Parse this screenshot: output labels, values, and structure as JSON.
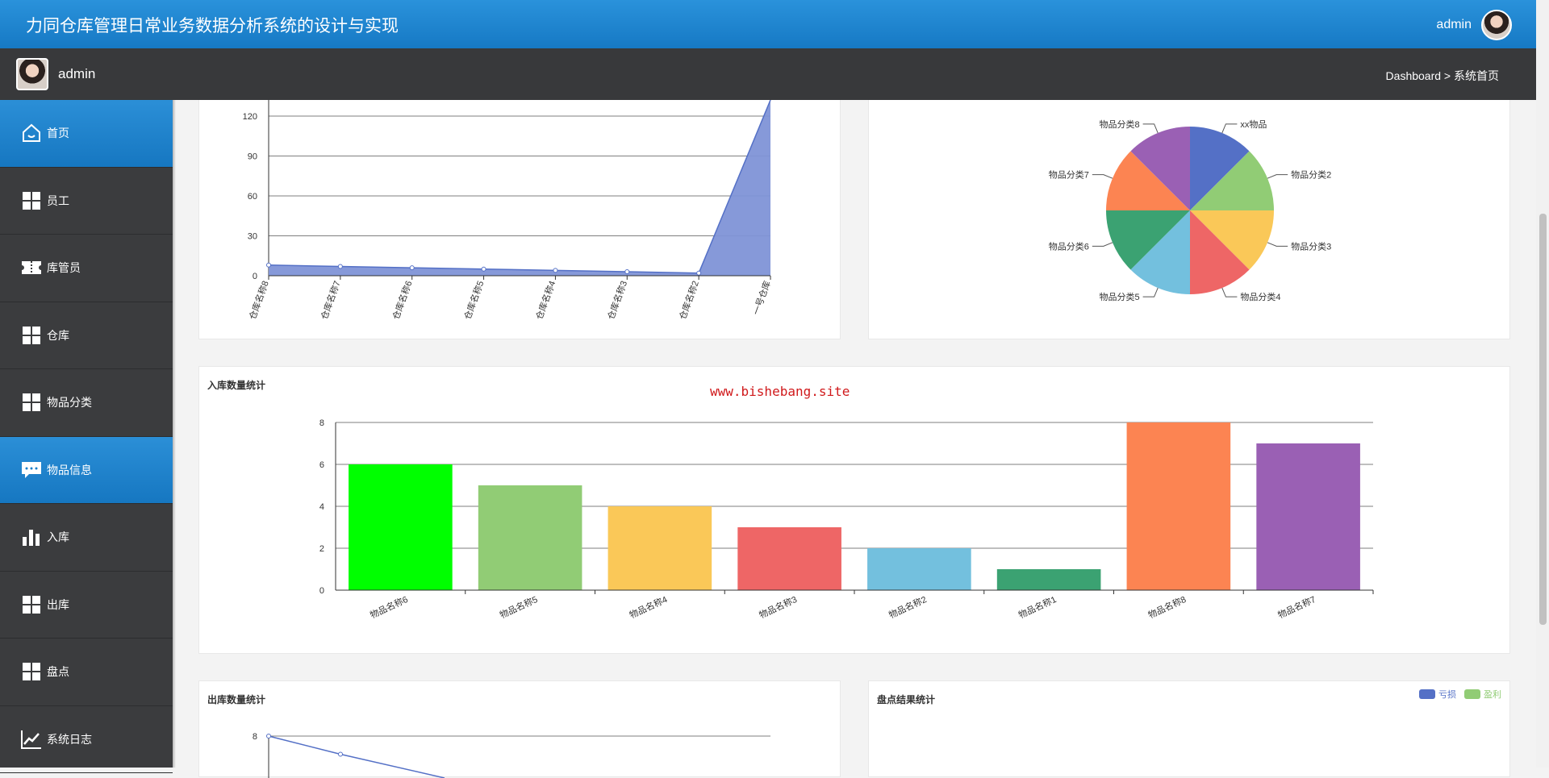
{
  "header": {
    "title": "力同仓库管理日常业务数据分析系统的设计与实现",
    "user": "admin"
  },
  "subheader": {
    "user": "admin",
    "breadcrumb": "Dashboard > 系统首页"
  },
  "sidebar": {
    "items": [
      {
        "label": "首页",
        "icon": "home-icon",
        "active": true
      },
      {
        "label": "员工",
        "icon": "grid-icon",
        "active": false
      },
      {
        "label": "库管员",
        "icon": "ticket-icon",
        "active": false
      },
      {
        "label": "仓库",
        "icon": "grid-icon",
        "active": false
      },
      {
        "label": "物品分类",
        "icon": "grid-icon",
        "active": false
      },
      {
        "label": "物品信息",
        "icon": "chat-icon",
        "active": true
      },
      {
        "label": "入库",
        "icon": "bar-chart-icon",
        "active": false
      },
      {
        "label": "出库",
        "icon": "grid-icon",
        "active": false
      },
      {
        "label": "盘点",
        "icon": "grid-icon",
        "active": false
      },
      {
        "label": "系统日志",
        "icon": "line-chart-icon",
        "active": false
      }
    ]
  },
  "watermark": "www.bishebang.site",
  "panels": {
    "inbound_title": "入库数量统计",
    "outbound_title": "出库数量统计",
    "inventory_title": "盘点结果统计",
    "inventory_legend": [
      "亏损",
      "盈利"
    ]
  },
  "colors": {
    "accent": "#1a7fca",
    "loss": "#5470c6",
    "profit": "#91cc75"
  },
  "chart_data": [
    {
      "type": "area",
      "categories": [
        "仓库名称8",
        "仓库名称7",
        "仓库名称6",
        "仓库名称5",
        "仓库名称4",
        "仓库名称3",
        "仓库名称2",
        "一号仓库"
      ],
      "values": [
        8,
        7,
        6,
        5,
        4,
        3,
        2,
        140
      ],
      "yticks": [
        0,
        30,
        60,
        90,
        120
      ],
      "color": "#7f93d7"
    },
    {
      "type": "pie",
      "labels": [
        "xx物品",
        "物品分类2",
        "物品分类3",
        "物品分类4",
        "物品分类5",
        "物品分类6",
        "物品分类7",
        "物品分类8"
      ],
      "values": [
        1,
        1,
        1,
        1,
        1,
        1,
        1,
        1
      ],
      "colors": [
        "#5470c6",
        "#91cc75",
        "#fac858",
        "#ee6666",
        "#73c0de",
        "#3ba272",
        "#fc8452",
        "#9a60b4"
      ]
    },
    {
      "type": "bar",
      "title": "入库数量统计",
      "categories": [
        "物品名称6",
        "物品名称5",
        "物品名称4",
        "物品名称3",
        "物品名称2",
        "物品名称1",
        "物品名称8",
        "物品名称7"
      ],
      "values": [
        6,
        5,
        4,
        3,
        2,
        1,
        8,
        7
      ],
      "colors": [
        "#00ff00",
        "#91cc75",
        "#fac858",
        "#ee6666",
        "#73c0de",
        "#3ba272",
        "#fc8452",
        "#9a60b4"
      ],
      "yticks": [
        0,
        2,
        4,
        6,
        8
      ]
    },
    {
      "type": "line",
      "title": "出库数量统计",
      "yticks_visible": [
        8
      ],
      "values_visible": [
        8,
        6.5
      ]
    }
  ]
}
